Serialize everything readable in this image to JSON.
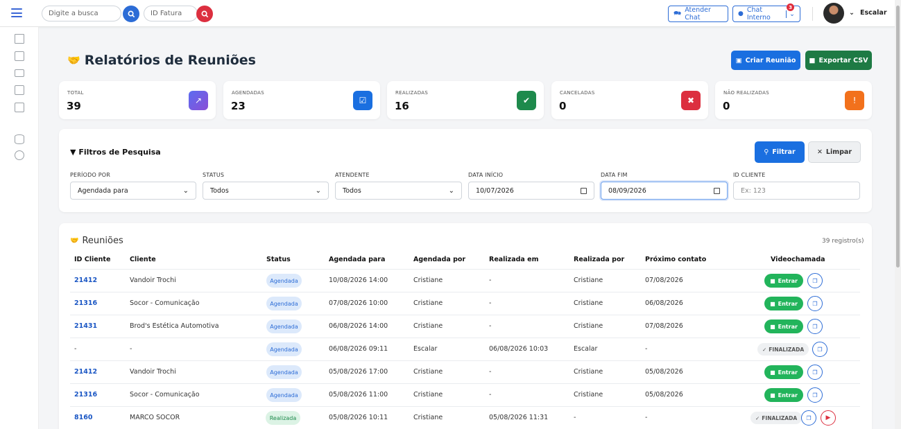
{
  "topbar": {
    "search_placeholder": "Digite a busca",
    "invoice_placeholder": "ID Fatura",
    "atender_chat": "Atender Chat",
    "chat_interno": "Chat Interno",
    "chat_badge": "3",
    "user_name": "Escalar"
  },
  "page": {
    "title": "Relatórios de Reuniões",
    "create_button": "Criar Reunião",
    "export_button": "Exportar CSV"
  },
  "stats": [
    {
      "label": "TOTAL",
      "value": "39",
      "color": "#6f42c1",
      "icon": "chart-icon"
    },
    {
      "label": "AGENDADAS",
      "value": "23",
      "color": "#1a6fe0",
      "icon": "calendar-check-icon"
    },
    {
      "label": "REALIZADAS",
      "value": "16",
      "color": "#1e8a4c",
      "icon": "check-icon"
    },
    {
      "label": "CANCELADAS",
      "value": "0",
      "color": "#dc2f3f",
      "icon": "x-circle-icon"
    },
    {
      "label": "NÃO REALIZADAS",
      "value": "0",
      "color": "#f2711c",
      "icon": "alert-icon"
    }
  ],
  "filters": {
    "title": "Filtros de Pesquisa",
    "filter_button": "Filtrar",
    "clear_button": "Limpar",
    "periodo_label": "PERÍODO POR",
    "periodo_value": "Agendada para",
    "status_label": "STATUS",
    "status_value": "Todos",
    "atendente_label": "ATENDENTE",
    "atendente_value": "Todos",
    "inicio_label": "DATA INÍCIO",
    "inicio_value": "10/07/2026",
    "fim_label": "DATA FIM",
    "fim_value": "08/09/2026",
    "cliente_label": "ID CLIENTE",
    "cliente_placeholder": "Ex: 123"
  },
  "table": {
    "title": "Reuniões",
    "count": "39 registro(s)",
    "columns": [
      "ID Cliente",
      "Cliente",
      "Status",
      "Agendada para",
      "Agendada por",
      "Realizada em",
      "Realizada por",
      "Próximo contato",
      "Videochamada"
    ],
    "entrar_label": "Entrar",
    "finalizada_label": "FINALIZADA",
    "rows": [
      {
        "id": "21412",
        "cliente": "Vandoir Trochi",
        "status": "Agendada",
        "agendada_para": "10/08/2026 14:00",
        "agendada_por": "Cristiane",
        "realizada_em": "-",
        "realizada_por": "Cristiane",
        "proximo": "07/08/2026",
        "video": "entrar"
      },
      {
        "id": "21316",
        "cliente": "Socor - Comunicação",
        "status": "Agendada",
        "agendada_para": "07/08/2026 10:00",
        "agendada_por": "Cristiane",
        "realizada_em": "-",
        "realizada_por": "Cristiane",
        "proximo": "06/08/2026",
        "video": "entrar"
      },
      {
        "id": "21431",
        "cliente": "Brod's Estética Automotiva",
        "status": "Agendada",
        "agendada_para": "06/08/2026 14:00",
        "agendada_por": "Cristiane",
        "realizada_em": "-",
        "realizada_por": "Cristiane",
        "proximo": "07/08/2026",
        "video": "entrar"
      },
      {
        "id": "-",
        "cliente": "-",
        "status": "Agendada",
        "agendada_para": "06/08/2026 09:11",
        "agendada_por": "Escalar",
        "realizada_em": "06/08/2026 10:03",
        "realizada_por": "Escalar",
        "proximo": "-",
        "video": "finalizada"
      },
      {
        "id": "21412",
        "cliente": "Vandoir Trochi",
        "status": "Agendada",
        "agendada_para": "05/08/2026 17:00",
        "agendada_por": "Cristiane",
        "realizada_em": "-",
        "realizada_por": "Cristiane",
        "proximo": "05/08/2026",
        "video": "entrar"
      },
      {
        "id": "21316",
        "cliente": "Socor - Comunicação",
        "status": "Agendada",
        "agendada_para": "05/08/2026 11:00",
        "agendada_por": "Cristiane",
        "realizada_em": "-",
        "realizada_por": "Cristiane",
        "proximo": "05/08/2026",
        "video": "entrar"
      },
      {
        "id": "8160",
        "cliente": "MARCO SOCOR",
        "status": "Realizada",
        "agendada_para": "05/08/2026 10:11",
        "agendada_por": "Cristiane",
        "realizada_em": "05/08/2026 11:31",
        "realizada_por": "-",
        "proximo": "-",
        "video": "finalizada-play"
      }
    ]
  }
}
